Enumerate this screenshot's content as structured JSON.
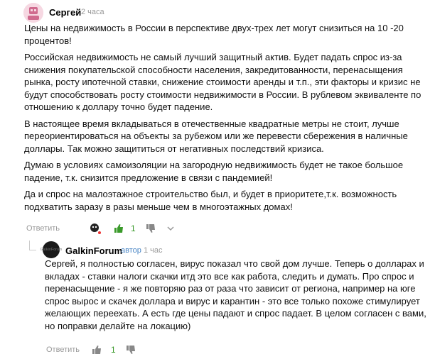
{
  "comment": {
    "author": "Сергей",
    "time": "2 часа",
    "paragraphs": [
      "Цены на недвижимость в России в перспективе двух-трех лет могут снизиться на 10 -20 процентов!",
      "Российская недвижимость не самый лучший защитный актив. Будет падать спрос из-за снижения покупательской способности населения, закредитованности, перенасыщения рынка, росту ипотечной ставки, снижение стоимости аренды и т.п., эти факторы и кризис не будут способствовать росту стоимости недвижимости в России. В рублевом эквиваленте по отношению к доллару точно будет падение.",
      "В настоящее время вкладываться в отечественные квадратные метры не стоит, лучше переориентироваться на объекты за рубежом или же перевести сбережения в наличные доллары. Так можно защититься от негативных последствий кризиса.",
      "Думаю в условиях самоизоляции на загородную недвижимость будет не такое большое падение, т.к. снизится предложение в связи с пандемией!",
      "Да и спрос на малоэтажное строительство был, и будет в приоритете,т.к. возможность подхватить заразу в разы меньше чем в многоэтажных домах!"
    ],
    "reply_label": "Ответить",
    "likes": "1"
  },
  "reply": {
    "author": "GalkinForum",
    "badge": "автор",
    "time": "1 час",
    "avatar_text": "GalkinForum",
    "paragraphs": [
      "Сергей, я полностью согласен, вирус показал что свой дом лучше. Теперь о долларах и вкладах - ставки налоги скачки итд это все как работа, следить и думать. Про спрос и перенасыщение - я же повторяю раз от раза что зависит от региона, например на юге спрос вырос и скачек доллара и вирус и карантин - это все только похоже стимулирует желающих переехать. А есть где цены падают и спрос падает. В целом согласен с вами, но поправки делайте на локацию)"
    ],
    "reply_label": "Ответить",
    "likes": "1"
  },
  "colors": {
    "like": "#3a9a2a",
    "muted": "#999999",
    "author_badge": "#4a86c5"
  }
}
